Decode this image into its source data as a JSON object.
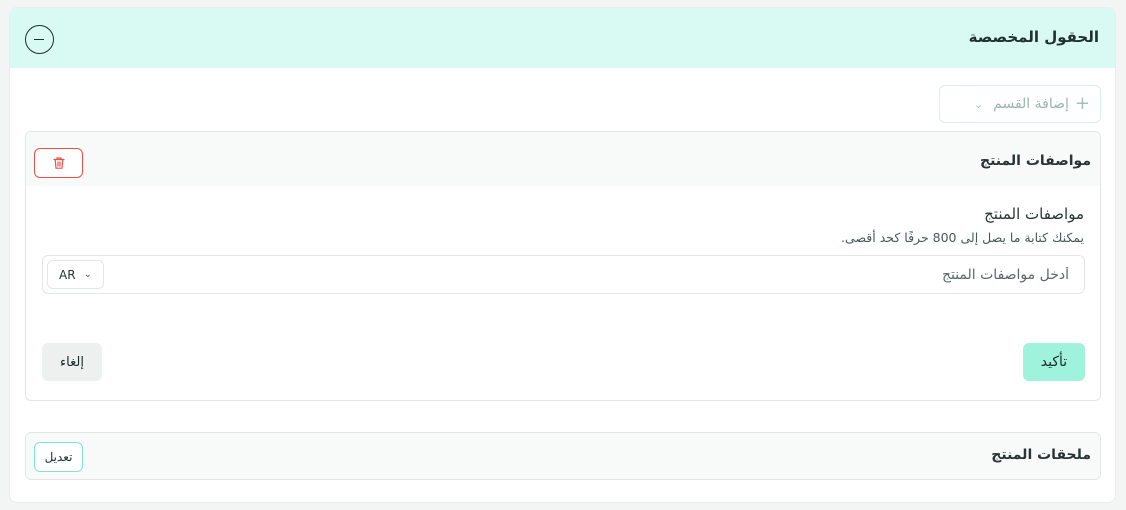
{
  "custom_fields": {
    "title": "الحقول المخصصة",
    "collapse_icon": "minus-circle-icon"
  },
  "add_section": {
    "label": "إضافة القسم",
    "plus_icon": "plus-icon",
    "chevron_icon": "chevron-down-icon"
  },
  "spec_section": {
    "title": "مواصفات المنتج",
    "delete_icon": "trash-icon",
    "field_label": "مواصفات المنتج",
    "help_text": "يمكنك كتابة ما يصل إلى 800 حرفًا كحد أقصى.",
    "input_value": "",
    "input_placeholder": "أدخل مواصفات المنتج",
    "language": "AR",
    "confirm_label": "تأكيد",
    "cancel_label": "إلغاء"
  },
  "attachments_section": {
    "title": "ملحقات المنتج",
    "edit_label": "تعديل"
  },
  "colors": {
    "header_bg": "#d9faf2",
    "accent": "#9ff3dd",
    "danger": "#e8524a"
  }
}
